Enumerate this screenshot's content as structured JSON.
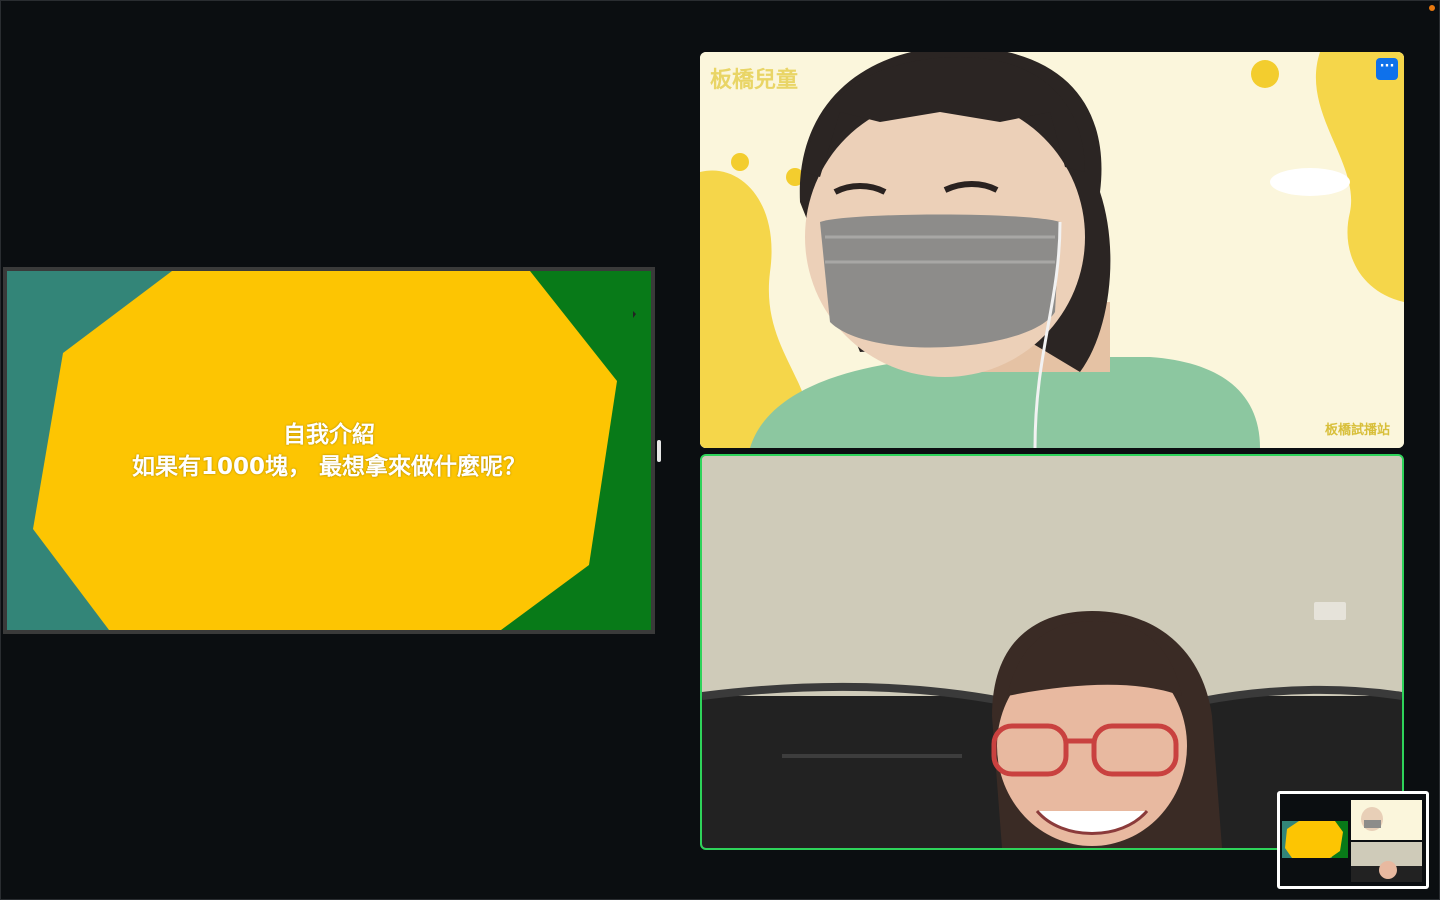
{
  "window": {
    "title": ""
  },
  "share": {
    "slide_title": "自我介紹",
    "slide_question": "如果有1000塊， 最想拿來做什麼呢？",
    "colors": {
      "left_bg": "#338578",
      "right_bg": "#087a18",
      "shape": "#fdc502",
      "text": "#ffffff"
    }
  },
  "participants": [
    {
      "background_title": "板橋兒童",
      "background_footer": "板橋試播站",
      "more_options_label": "···",
      "speaking": false
    },
    {
      "speaking": true
    }
  ],
  "accent": {
    "speaking_border": "#2ed35a",
    "button_blue": "#0e71eb",
    "record_dot": "#e8780f"
  },
  "icons": [
    "more-options-icon",
    "record-indicator-icon",
    "cursor-icon"
  ]
}
